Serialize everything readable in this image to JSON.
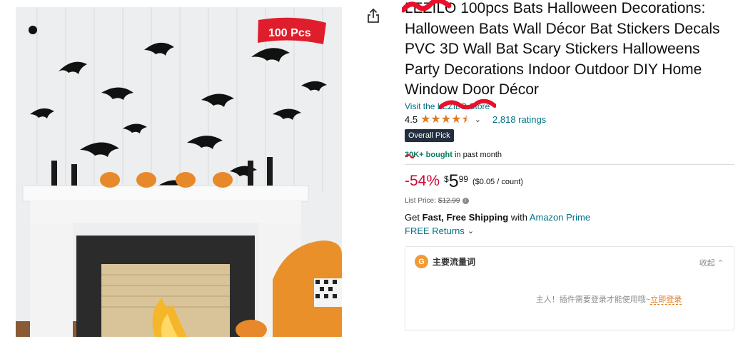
{
  "image": {
    "badge_text": "100 Pcs"
  },
  "share": {
    "icon": "share-icon"
  },
  "product": {
    "title": "LEZILO 100pcs Bats Halloween Decorations: Halloween Bats Wall Décor Bat Stickers Decals PVC 3D Wall Bat Scary Stickers Halloweens Party Decorations Indoor Outdoor DIY Home Window Door Décor",
    "store_link": "Visit the LEZILO Store",
    "rating_value": "4.5",
    "ratings_count": "2,818 ratings",
    "badge": "Overall Pick",
    "bought_bold": "30K+ bought",
    "bought_rest": " in past month"
  },
  "price": {
    "discount": "-54%",
    "currency": "$",
    "whole": "5",
    "fraction": "99",
    "unit_price": "($0.05 / count)",
    "list_price_label": "List Price:",
    "list_price_value": "$12.99"
  },
  "shipping": {
    "prefix": "Get ",
    "bold": "Fast, Free Shipping",
    "middle": " with ",
    "prime": "Amazon Prime",
    "returns": "FREE Returns"
  },
  "panel": {
    "icon_letter": "G",
    "title": "主要流量词",
    "collapse": "收起",
    "message": "主人！插件需要登录才能使用哦~",
    "login": "立即登录"
  },
  "colors": {
    "link": "#007185",
    "discount": "#cc0c39",
    "star": "#de7921",
    "badge_bg": "#232f3e",
    "bought_green": "#067d62",
    "plugin_orange": "#e07b20",
    "redaction": "#e8102a"
  }
}
